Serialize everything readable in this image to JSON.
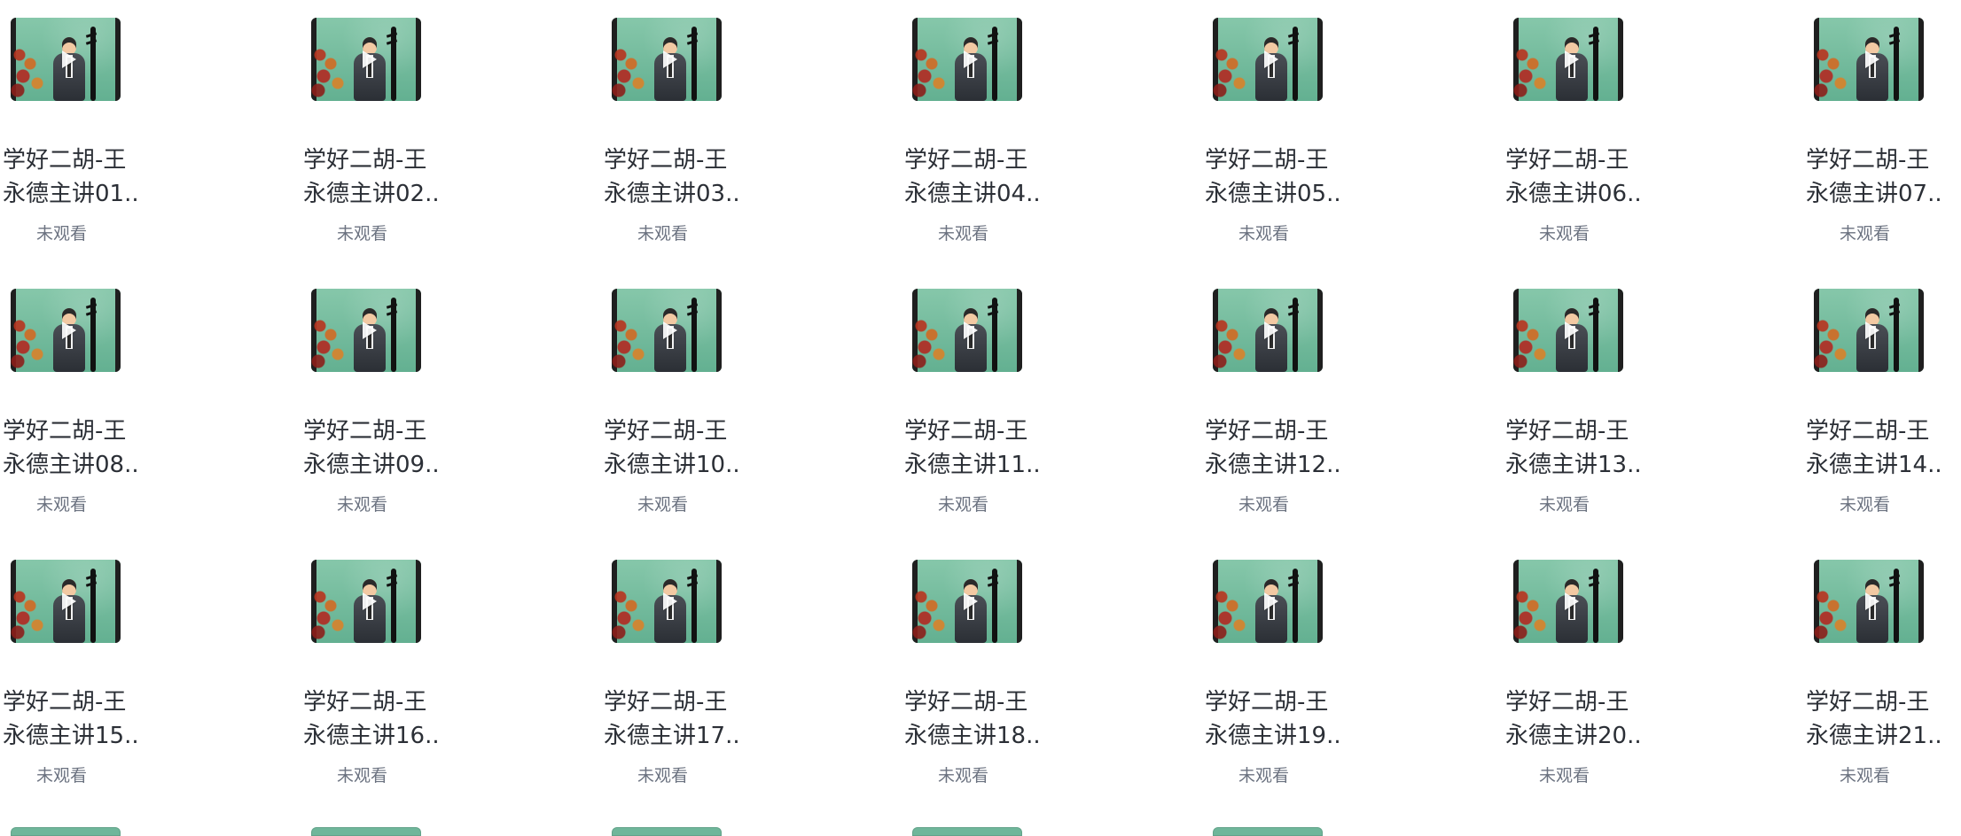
{
  "video_grid": {
    "items": [
      {
        "title": "学好二胡-王\n永德主讲01..",
        "status": "未观看"
      },
      {
        "title": "学好二胡-王\n永德主讲02..",
        "status": "未观看"
      },
      {
        "title": "学好二胡-王\n永德主讲03..",
        "status": "未观看"
      },
      {
        "title": "学好二胡-王\n永德主讲04..",
        "status": "未观看"
      },
      {
        "title": "学好二胡-王\n永德主讲05..",
        "status": "未观看"
      },
      {
        "title": "学好二胡-王\n永德主讲06..",
        "status": "未观看"
      },
      {
        "title": "学好二胡-王\n永德主讲07..",
        "status": "未观看"
      },
      {
        "title": "学好二胡-王\n永德主讲08..",
        "status": "未观看"
      },
      {
        "title": "学好二胡-王\n永德主讲09..",
        "status": "未观看"
      },
      {
        "title": "学好二胡-王\n永德主讲10..",
        "status": "未观看"
      },
      {
        "title": "学好二胡-王\n永德主讲11..",
        "status": "未观看"
      },
      {
        "title": "学好二胡-王\n永德主讲12..",
        "status": "未观看"
      },
      {
        "title": "学好二胡-王\n永德主讲13..",
        "status": "未观看"
      },
      {
        "title": "学好二胡-王\n永德主讲14..",
        "status": "未观看"
      },
      {
        "title": "学好二胡-王\n永德主讲15..",
        "status": "未观看"
      },
      {
        "title": "学好二胡-王\n永德主讲16..",
        "status": "未观看"
      },
      {
        "title": "学好二胡-王\n永德主讲17..",
        "status": "未观看"
      },
      {
        "title": "学好二胡-王\n永德主讲18..",
        "status": "未观看"
      },
      {
        "title": "学好二胡-王\n永德主讲19..",
        "status": "未观看"
      },
      {
        "title": "学好二胡-王\n永德主讲20..",
        "status": "未观看"
      },
      {
        "title": "学好二胡-王\n永德主讲21..",
        "status": "未观看"
      }
    ]
  },
  "colors": {
    "thumbnail_bg": "#6fb69a",
    "title_text": "#2b2f36",
    "status_text": "#6b7280"
  },
  "icons": {
    "play": "play-icon"
  }
}
